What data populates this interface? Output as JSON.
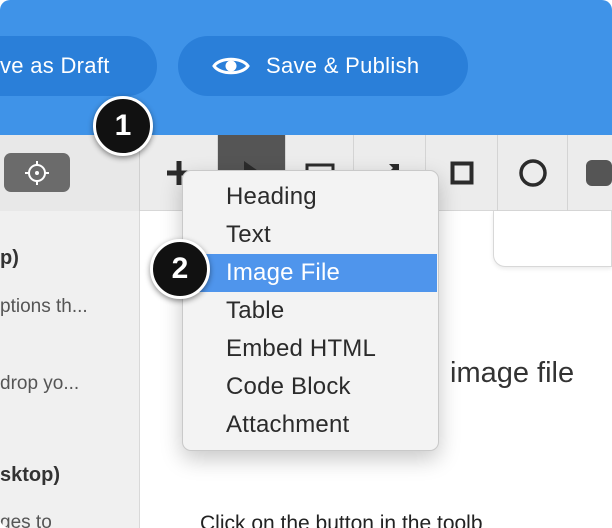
{
  "header": {
    "draft_button_label": "ve as Draft",
    "publish_button_label": "Save & Publish",
    "publish_icon": "eye-icon"
  },
  "toolbar": {
    "tools": [
      {
        "icon": "plus-icon"
      },
      {
        "icon": "pointer-icon",
        "active": true
      },
      {
        "icon": "rectangle-icon"
      },
      {
        "icon": "arrow-icon"
      },
      {
        "icon": "square-icon"
      },
      {
        "icon": "circle-icon"
      },
      {
        "icon": "rounded-square-icon"
      }
    ],
    "left_button_icon": "crosshair-icon"
  },
  "sidebar": {
    "lines": [
      "p)",
      "ptions th...",
      "drop yo...",
      "sktop)",
      "ges to"
    ]
  },
  "main": {
    "heading": "image file",
    "body": "Click on the  button in the toolb"
  },
  "dropdown": {
    "items": [
      "Heading",
      "Text",
      "Image File",
      "Table",
      "Embed HTML",
      "Code Block",
      "Attachment"
    ],
    "selected": "Image File"
  },
  "steps": {
    "step1": "1",
    "step2": "2"
  },
  "colors": {
    "header_blue": "#3f93e8",
    "button_blue": "#2a7fd9",
    "selection_blue": "#4f95ec"
  }
}
